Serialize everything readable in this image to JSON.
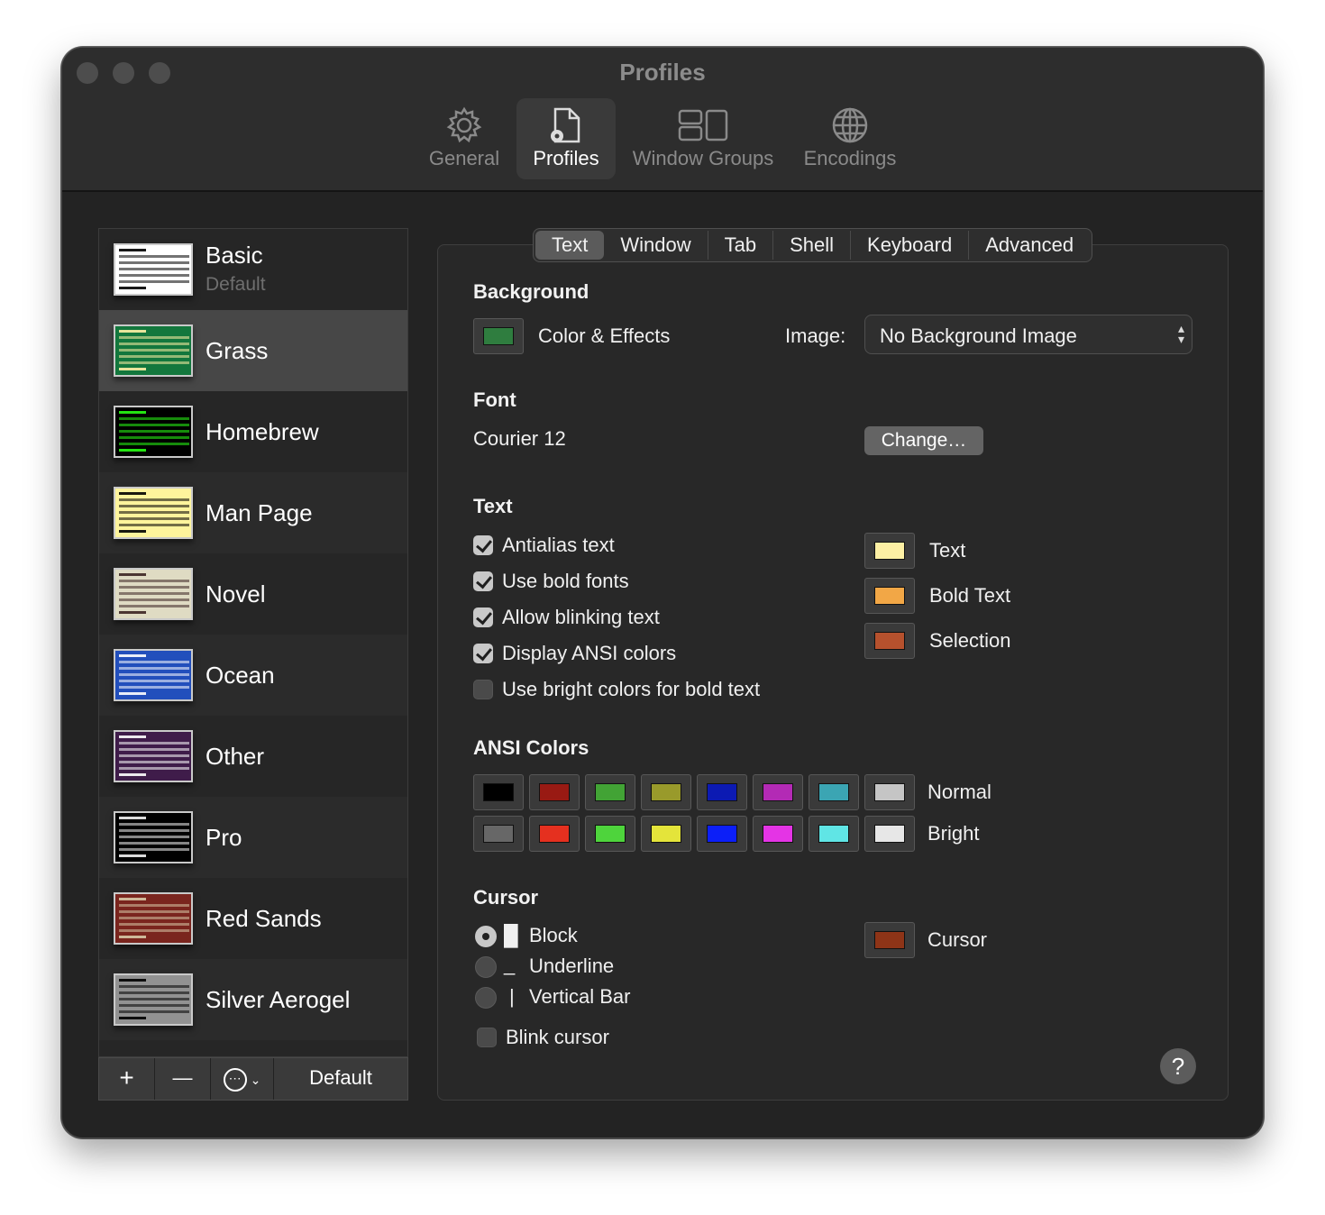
{
  "window": {
    "title": "Profiles"
  },
  "toolbar": {
    "items": [
      {
        "label": "General",
        "icon": "gear-icon"
      },
      {
        "label": "Profiles",
        "icon": "profile-document-icon"
      },
      {
        "label": "Window Groups",
        "icon": "window-groups-icon"
      },
      {
        "label": "Encodings",
        "icon": "globe-icon"
      }
    ],
    "active": "Profiles"
  },
  "sidebar": {
    "profiles": [
      {
        "name": "Basic",
        "subtitle": "Default",
        "bg": "#ffffff",
        "fg": "#000000"
      },
      {
        "name": "Grass",
        "subtitle": "",
        "bg": "#13773d",
        "fg": "#fff0a5"
      },
      {
        "name": "Homebrew",
        "subtitle": "",
        "bg": "#000000",
        "fg": "#28fe14"
      },
      {
        "name": "Man Page",
        "subtitle": "",
        "bg": "#fef49c",
        "fg": "#000000"
      },
      {
        "name": "Novel",
        "subtitle": "",
        "bg": "#dfdbc3",
        "fg": "#3b2322"
      },
      {
        "name": "Ocean",
        "subtitle": "",
        "bg": "#224fbc",
        "fg": "#ffffff"
      },
      {
        "name": "Other",
        "subtitle": "",
        "bg": "#3f1c4a",
        "fg": "#ffffff"
      },
      {
        "name": "Pro",
        "subtitle": "",
        "bg": "#000000",
        "fg": "#f2f2f2"
      },
      {
        "name": "Red Sands",
        "subtitle": "",
        "bg": "#7a251e",
        "fg": "#d7c9a7"
      },
      {
        "name": "Silver Aerogel",
        "subtitle": "",
        "bg": "#929292",
        "fg": "#000000"
      }
    ],
    "selected": "Grass",
    "footer": {
      "add": "+",
      "remove": "—",
      "more": "⋯",
      "default_label": "Default"
    }
  },
  "tabs": {
    "items": [
      "Text",
      "Window",
      "Tab",
      "Shell",
      "Keyboard",
      "Advanced"
    ],
    "active": "Text"
  },
  "background": {
    "title": "Background",
    "color_effects_label": "Color & Effects",
    "color": "#2f7d3f",
    "image_label": "Image:",
    "image_value": "No Background Image"
  },
  "font": {
    "title": "Font",
    "value": "Courier 12",
    "change_label": "Change…"
  },
  "text": {
    "title": "Text",
    "options": [
      {
        "label": "Antialias text",
        "checked": true
      },
      {
        "label": "Use bold fonts",
        "checked": true
      },
      {
        "label": "Allow blinking text",
        "checked": true
      },
      {
        "label": "Display ANSI colors",
        "checked": true
      },
      {
        "label": "Use bright colors for bold text",
        "checked": false
      }
    ],
    "colors": [
      {
        "label": "Text",
        "color": "#fdf0a4"
      },
      {
        "label": "Bold Text",
        "color": "#f2a746"
      },
      {
        "label": "Selection",
        "color": "#b6512d"
      }
    ]
  },
  "ansi": {
    "title": "ANSI Colors",
    "normal_label": "Normal",
    "bright_label": "Bright",
    "normal": [
      "#000000",
      "#991a13",
      "#42a335",
      "#999a2b",
      "#0c1ab3",
      "#b32ab5",
      "#3ba5b3",
      "#c5c5c5"
    ],
    "bright": [
      "#676767",
      "#e5301f",
      "#4ed43c",
      "#e4e43a",
      "#0c1ff8",
      "#e434e5",
      "#60e5e5",
      "#e7e7e7"
    ]
  },
  "cursor": {
    "title": "Cursor",
    "shapes": [
      {
        "label": "Block",
        "glyph": "█",
        "selected": true
      },
      {
        "label": "Underline",
        "glyph": "_",
        "selected": false
      },
      {
        "label": "Vertical Bar",
        "glyph": "|",
        "selected": false
      }
    ],
    "blink_label": "Blink cursor",
    "blink": false,
    "color_label": "Cursor",
    "color": "#8e3417"
  },
  "help_label": "?"
}
